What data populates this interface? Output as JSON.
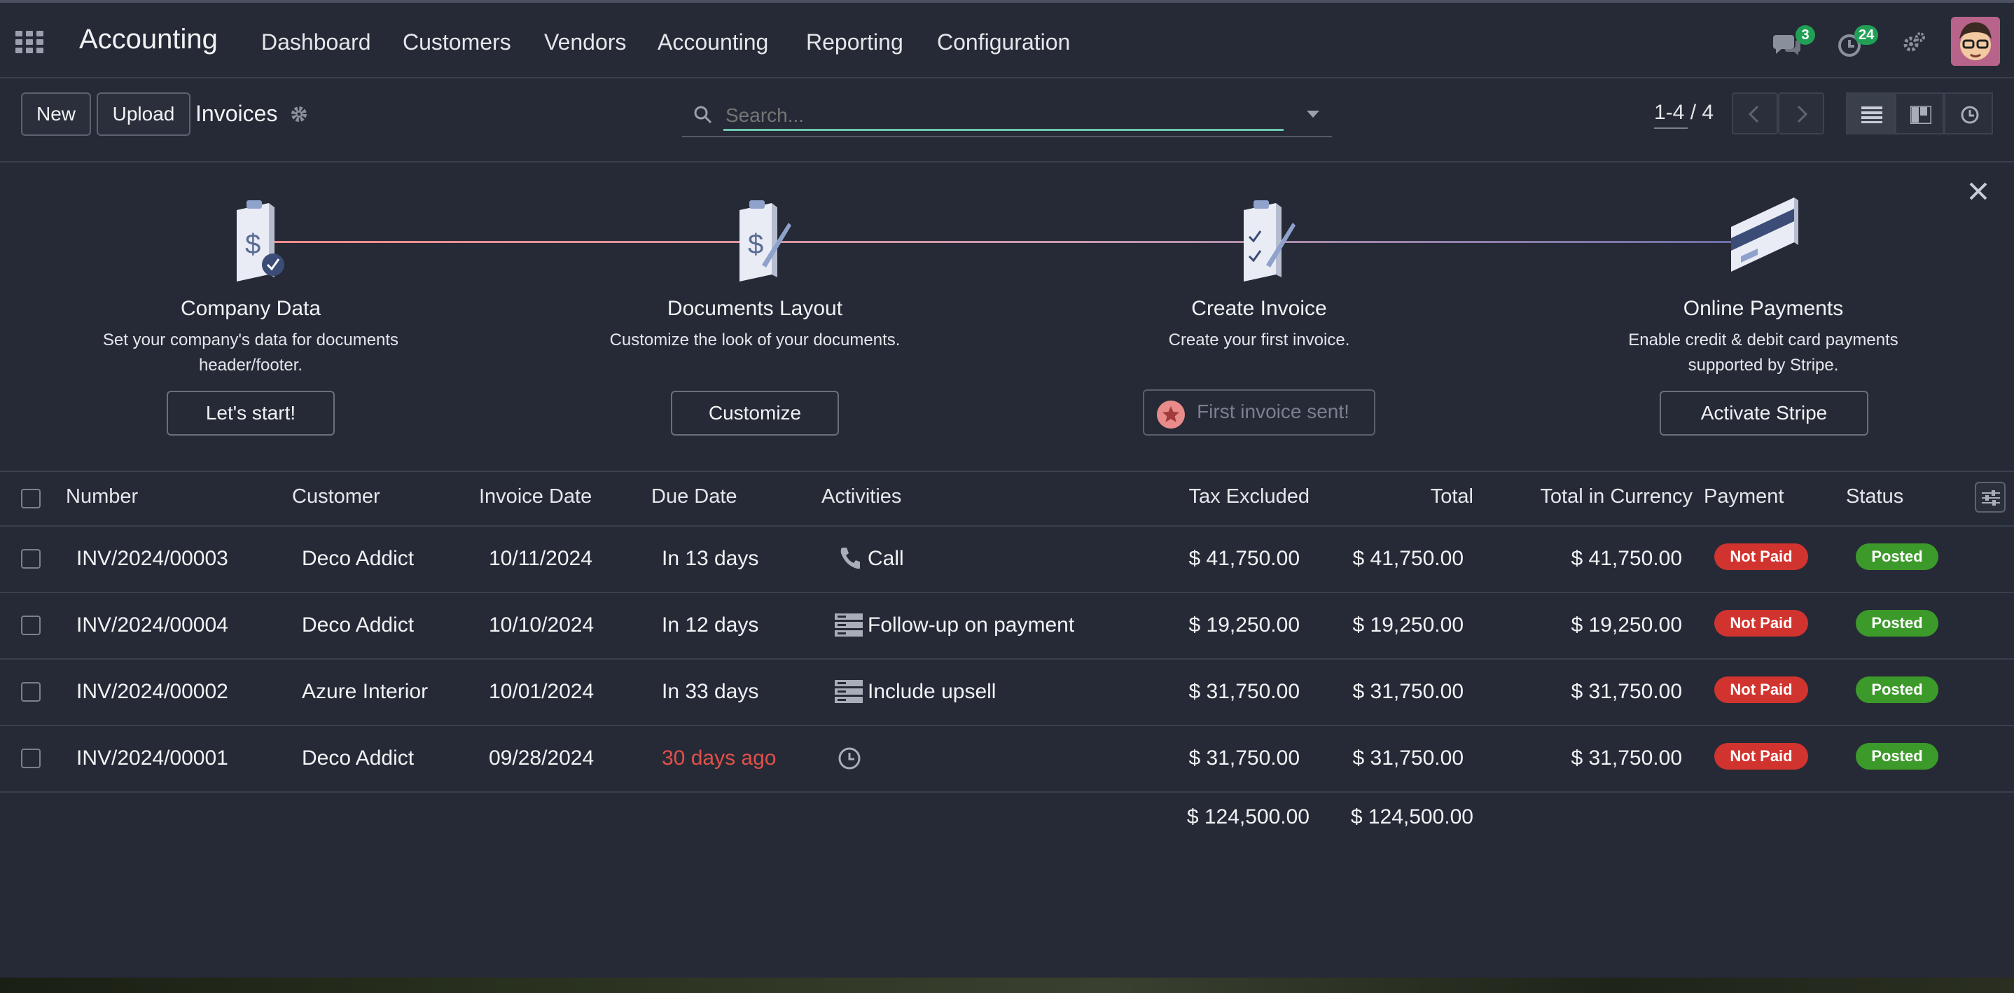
{
  "navbar": {
    "app_name": "Accounting",
    "menu": [
      "Dashboard",
      "Customers",
      "Vendors",
      "Accounting",
      "Reporting",
      "Configuration"
    ],
    "messages_count": "3",
    "activities_count": "24"
  },
  "control_panel": {
    "new_label": "New",
    "upload_label": "Upload",
    "title": "Invoices",
    "search_placeholder": "Search...",
    "pager": "1-4 / 4"
  },
  "onboarding": {
    "steps": [
      {
        "title": "Company Data",
        "desc_line1": "Set your company's data for documents",
        "desc_line2": "header/footer.",
        "button": "Let's start!",
        "icon": "clipboard-dollar-check-icon"
      },
      {
        "title": "Documents Layout",
        "desc_line1": "Customize the look of your documents.",
        "desc_line2": "",
        "button": "Customize",
        "icon": "clipboard-dollar-pen-icon"
      },
      {
        "title": "Create Invoice",
        "desc_line1": "Create your first invoice.",
        "desc_line2": "",
        "button": "First invoice sent!",
        "icon": "clipboard-checklist-icon"
      },
      {
        "title": "Online Payments",
        "desc_line1": "Enable credit & debit card payments",
        "desc_line2": "supported by Stripe.",
        "button": "Activate Stripe",
        "icon": "credit-card-icon"
      }
    ]
  },
  "table": {
    "headers": {
      "number": "Number",
      "customer": "Customer",
      "invoice_date": "Invoice Date",
      "due_date": "Due Date",
      "activities": "Activities",
      "tax_excluded": "Tax Excluded",
      "total": "Total",
      "total_currency": "Total in Currency",
      "payment": "Payment",
      "status": "Status"
    },
    "rows": [
      {
        "number": "INV/2024/00003",
        "customer": "Deco Addict",
        "invoice_date": "10/11/2024",
        "due_date": "In 13 days",
        "activity": "Call",
        "activity_icon": "phone-icon",
        "tax_excluded": "$ 41,750.00",
        "total": "$ 41,750.00",
        "total_currency": "$ 41,750.00",
        "payment": "Not Paid",
        "status": "Posted"
      },
      {
        "number": "INV/2024/00004",
        "customer": "Deco Addict",
        "invoice_date": "10/10/2024",
        "due_date": "In 12 days",
        "activity": "Follow-up on payment",
        "activity_icon": "server-list-icon",
        "tax_excluded": "$ 19,250.00",
        "total": "$ 19,250.00",
        "total_currency": "$ 19,250.00",
        "payment": "Not Paid",
        "status": "Posted"
      },
      {
        "number": "INV/2024/00002",
        "customer": "Azure Interior",
        "invoice_date": "10/01/2024",
        "due_date": "In 33 days",
        "activity": "Include upsell",
        "activity_icon": "server-list-icon",
        "tax_excluded": "$ 31,750.00",
        "total": "$ 31,750.00",
        "total_currency": "$ 31,750.00",
        "payment": "Not Paid",
        "status": "Posted"
      },
      {
        "number": "INV/2024/00001",
        "customer": "Deco Addict",
        "invoice_date": "09/28/2024",
        "due_date": "30 days ago",
        "activity": "",
        "activity_icon": "clock-icon",
        "tax_excluded": "$ 31,750.00",
        "total": "$ 31,750.00",
        "total_currency": "$ 31,750.00",
        "payment": "Not Paid",
        "status": "Posted"
      }
    ],
    "totals": {
      "tax_excluded": "$ 124,500.00",
      "total": "$ 124,500.00"
    }
  },
  "colors": {
    "late": "#e0514a",
    "not_paid": "#d1342f",
    "posted": "#3c9a2a",
    "badge": "#21a055",
    "search_focus": "#6fc7b0"
  }
}
